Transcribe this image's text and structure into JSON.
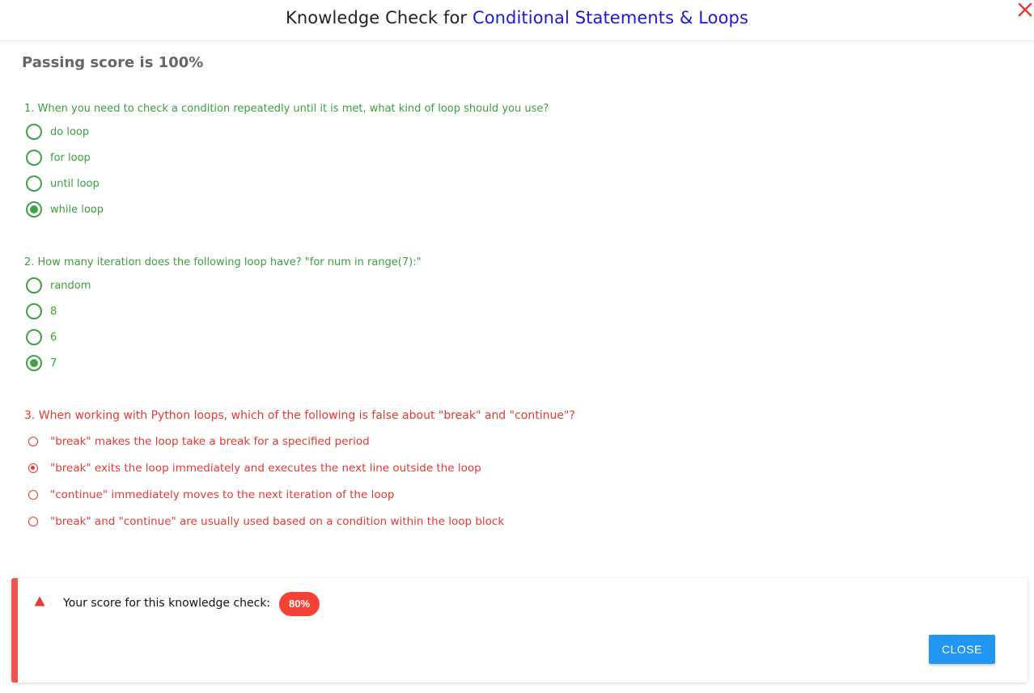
{
  "header": {
    "title_prefix": "Knowledge Check for",
    "title_topic": "Conditional Statements & Loops",
    "accent_color": "#1a1ad6",
    "close_icon": "close-x-icon"
  },
  "passing_score": "Passing score is 100%",
  "questions": [
    {
      "text": "1. When you need to check a condition repeatedly until it is met, what kind of loop should you use?",
      "status": "correct",
      "options": [
        {
          "label": "do loop",
          "selected": false
        },
        {
          "label": "for loop",
          "selected": false
        },
        {
          "label": "until loop",
          "selected": false
        },
        {
          "label": "while loop",
          "selected": true
        }
      ]
    },
    {
      "text": "2. How many iteration does the following loop have? \"for num in range(7):\"",
      "status": "correct",
      "options": [
        {
          "label": "random",
          "selected": false
        },
        {
          "label": "8",
          "selected": false
        },
        {
          "label": "6",
          "selected": false
        },
        {
          "label": "7",
          "selected": true
        }
      ]
    },
    {
      "text": "3. When working with Python loops, which of the following is false about \"break\" and \"continue\"?",
      "status": "incorrect",
      "options": [
        {
          "label": "\"break\" makes the loop take a break for a specified period",
          "selected": false
        },
        {
          "label": "\"break\" exits the loop immediately and executes the next line outside the loop",
          "selected": true
        },
        {
          "label": "\"continue\" immediately moves to the next iteration of the loop",
          "selected": false
        },
        {
          "label": "\"break\" and \"continue\" are usually used based on a condition within the loop block",
          "selected": false
        }
      ]
    }
  ],
  "result": {
    "icon": "warning-icon",
    "text": "Your score for this knowledge check:",
    "score": "80%",
    "close_label": "CLOSE"
  },
  "colors": {
    "correct": "#3aa13a",
    "incorrect": "#e53935",
    "button": "#2196f3",
    "badge": "#f44336"
  }
}
